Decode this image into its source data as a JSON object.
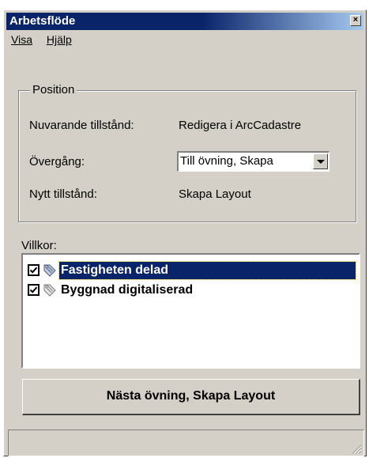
{
  "window": {
    "title": "Arbetsflöde",
    "close_glyph": "×"
  },
  "menu": [
    {
      "label": "Visa",
      "mnemonic": "V"
    },
    {
      "label": "Hjälp",
      "mnemonic": "H"
    }
  ],
  "position": {
    "legend": "Position",
    "current_state_label": "Nuvarande tillstånd:",
    "current_state_value": "Redigera i ArcCadastre",
    "transition_label": "Övergång:",
    "transition_value": "Till övning, Skapa",
    "new_state_label": "Nytt tillstånd:",
    "new_state_value": "Skapa Layout"
  },
  "conditions": {
    "label": "Villkor:",
    "items": [
      {
        "text": "Fastigheten delad",
        "checked": true,
        "selected": true,
        "icon": "tag-icon"
      },
      {
        "text": "Byggnad digitaliserad",
        "checked": true,
        "selected": false,
        "icon": "tag-icon"
      }
    ]
  },
  "next_button": {
    "label": "Nästa övning, Skapa Layout"
  },
  "colors": {
    "face": "#d4d0c8",
    "title_active": "#0a246a",
    "title_gradient_end": "#a6caf0",
    "selection": "#0a246a"
  }
}
